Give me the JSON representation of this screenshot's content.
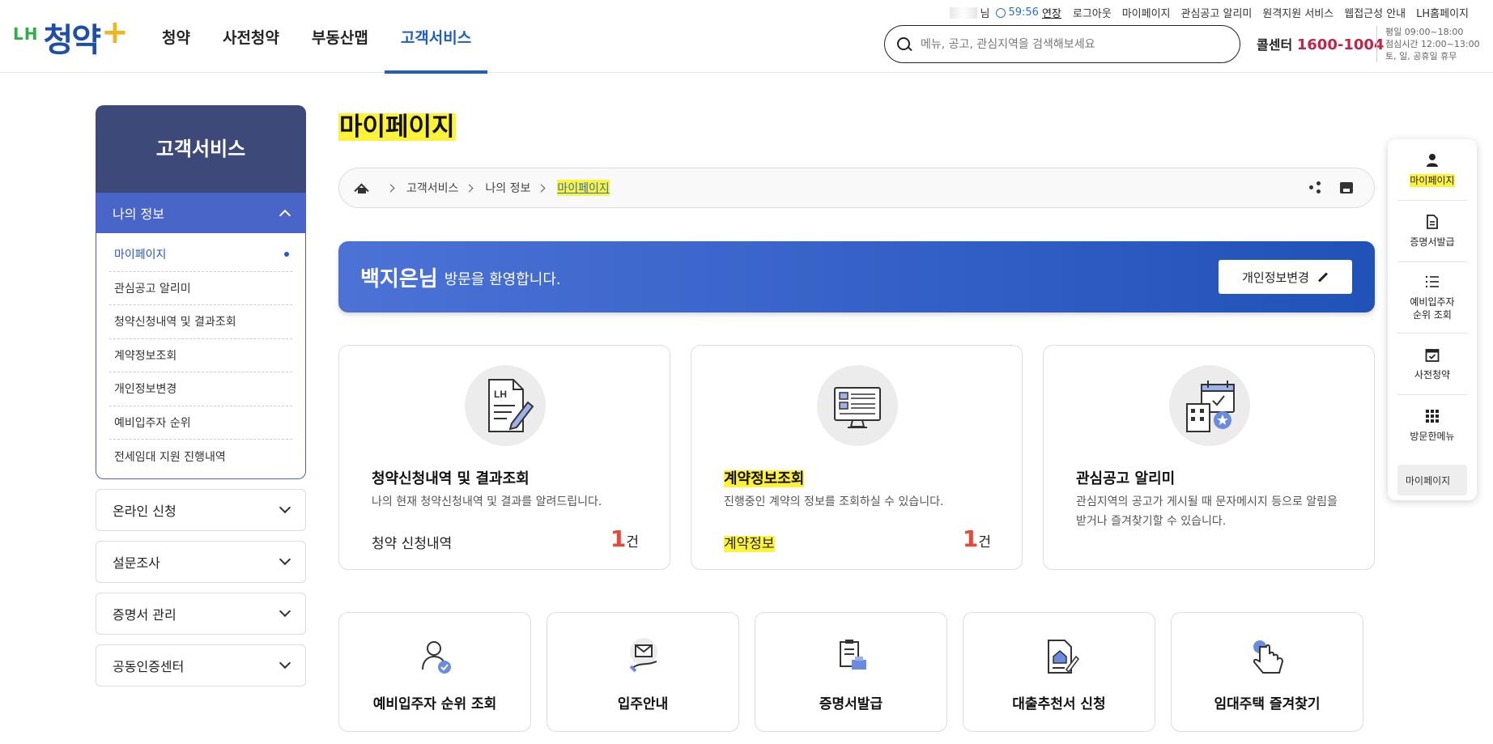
{
  "header": {
    "logo_lh": "LH",
    "logo_brand": "청약",
    "logo_plus": "+",
    "nav": [
      "청약",
      "사전청약",
      "부동산맵",
      "고객서비스"
    ],
    "active_nav_index": 3,
    "user_suffix": "님",
    "session_timer": "59:56",
    "extend_label": "연장",
    "util_links": [
      "로그아웃",
      "마이페이지",
      "관심공고 알리미",
      "원격지원 서비스",
      "웹접근성 안내",
      "LH홈페이지"
    ],
    "search_placeholder": "메뉴, 공고, 관심지역을 검색해보세요",
    "callcenter_label": "콜센터",
    "callcenter_number": "1600-1004",
    "hours": [
      "평일 09:00~18:00",
      "점심시간 12:00~13:00",
      "토, 일, 공휴일 휴무"
    ]
  },
  "sidebar": {
    "title": "고객서비스",
    "open_group": "나의 정보",
    "sub_items": [
      "마이페이지",
      "관심공고 알리미",
      "청약신청내역 및 결과조회",
      "계약정보조회",
      "개인정보변경",
      "예비입주자 순위",
      "전세임대 지원 진행내역"
    ],
    "active_sub_index": 0,
    "groups": [
      "온라인 신청",
      "설문조사",
      "증명서 관리",
      "공동인증센터"
    ]
  },
  "main": {
    "page_title": "마이페이지",
    "breadcrumb": [
      "고객서비스",
      "나의 정보",
      "마이페이지"
    ],
    "welcome_name": "백지은님",
    "welcome_msg": "방문을 환영합니다.",
    "edit_button": "개인정보변경",
    "cards": [
      {
        "title": "청약신청내역 및 결과조회",
        "desc": "나의 현재 청약신청내역 및 결과를 알려드립니다.",
        "foot": "청약 신청내역",
        "count": "1",
        "unit": "건"
      },
      {
        "title": "계약정보조회",
        "desc": "진행중인 계약의 정보를 조회하실 수 있습니다.",
        "foot": "계약정보",
        "count": "1",
        "unit": "건"
      },
      {
        "title": "관심공고 알리미",
        "desc": "관심지역의 공고가 게시될 때 문자메시지 등으로 알림을 받거나 즐겨찾기할 수 있습니다."
      }
    ],
    "quick_cards": [
      "예비입주자 순위 조회",
      "입주안내",
      "증명서발급",
      "대출추천서 신청",
      "임대주택 즐겨찾기"
    ]
  },
  "quick_menu": {
    "items": [
      "마이페이지",
      "증명서발급",
      "예비입주자\n순위 조회",
      "사전청약",
      "방문한메뉴"
    ],
    "recent": "마이페이지"
  },
  "colors": {
    "primary": "#1f5fc1",
    "sidebar_title_bg": "#3c4979",
    "sidebar_active_bg": "#4965c8",
    "callcenter_red": "#c0264b",
    "count_red": "#e8473a",
    "highlight": "#fff23a"
  }
}
